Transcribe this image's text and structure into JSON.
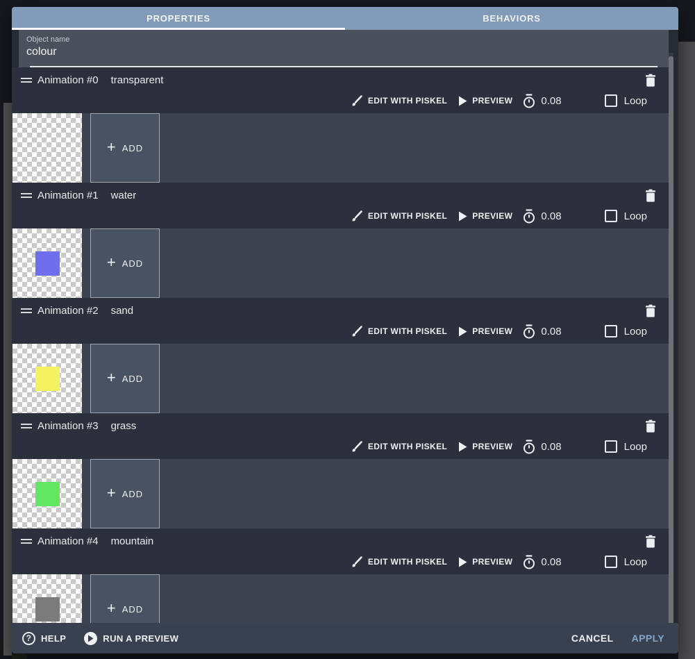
{
  "window": {
    "tabs": [
      {
        "label": "PROPERTIES"
      },
      {
        "label": "BEHAVIORS"
      }
    ],
    "object_name_label": "Object name",
    "object_name_value": "colour",
    "controls": {
      "edit_label": "EDIT WITH PISKEL",
      "preview_label": "PREVIEW",
      "frame_time": "0.08",
      "loop_label": "Loop",
      "loop_checked": false,
      "add_label": "ADD"
    },
    "animations": [
      {
        "title": "Animation #0",
        "name": "transparent",
        "frame_color": null
      },
      {
        "title": "Animation #1",
        "name": "water",
        "frame_color": "#6e6eee"
      },
      {
        "title": "Animation #2",
        "name": "sand",
        "frame_color": "#f3f35f"
      },
      {
        "title": "Animation #3",
        "name": "grass",
        "frame_color": "#62e762"
      },
      {
        "title": "Animation #4",
        "name": "mountain",
        "frame_color": "#7b7b7b"
      }
    ],
    "footer": {
      "help_label": "HELP",
      "run_label": "RUN A PREVIEW",
      "cancel_label": "CANCEL",
      "apply_label": "APPLY"
    },
    "colors": {
      "tab_bar": "#829bb8",
      "header_row": "#2b303c",
      "frames_row": "#3d4351",
      "apply_text": "#84a7c9"
    }
  }
}
